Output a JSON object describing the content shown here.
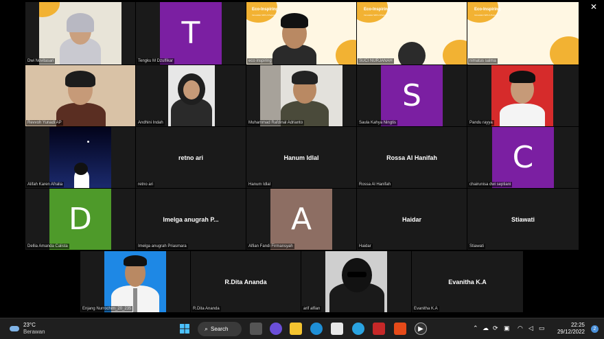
{
  "window": {
    "close_glyph": "✕"
  },
  "participants": [
    {
      "name": "Dwi Novitasari"
    },
    {
      "name": "Tengku M Dzulfikar",
      "initial": "T",
      "color": "#7b1fa2"
    },
    {
      "name": "eco inspiring",
      "banner": "Eco-Inspiring",
      "banner_sub": "Innovation With A Purpose"
    },
    {
      "name": "SUCI NURJANAH",
      "banner": "Eco-Inspiring",
      "banner_sub": "Innovation With A Purpose"
    },
    {
      "name": "nimatus salma",
      "banner": "Eco-Inspiring",
      "banner_sub": "Innovation With A Purpose"
    },
    {
      "name": "Revvoh Yunadi AP"
    },
    {
      "name": "Andhini Indah"
    },
    {
      "name": "Muhammad Rafdinal Adrianto"
    },
    {
      "name": "Saula Kahya Ningtis",
      "initial": "S",
      "color": "#7b1fa2"
    },
    {
      "name": "Pandu rayya"
    },
    {
      "name": "Alifah Karen Afralia"
    },
    {
      "name": "retno ari",
      "display": "retno ari"
    },
    {
      "name": "Hanum Idlal",
      "display": "Hanum Idlal"
    },
    {
      "name": "Rossa Al Hanifah",
      "display": "Rossa Al Hanifah"
    },
    {
      "name": "chairunisa dwi septiani",
      "initial": "C",
      "color": "#7b1fa2"
    },
    {
      "name": "Dellia Amanda Calista",
      "initial": "D",
      "color": "#4e9a2a"
    },
    {
      "name": "Imelga anugrah Priasmara",
      "display": "Imelga anugrah P..."
    },
    {
      "name": "Alfian Fandi Firmansyah",
      "initial": "A",
      "color": "#8d6e63"
    },
    {
      "name": "Haidar",
      "display": "Haidar"
    },
    {
      "name": "Stiawati",
      "display": "Stiawati"
    },
    {
      "name": "Enjang Nurrochim_20_235"
    },
    {
      "name": "R.Dita Ananda",
      "display": "R.Dita Ananda"
    },
    {
      "name": "arif alfian"
    },
    {
      "name": "Evanitha K.A",
      "display": "Evanitha K.A"
    }
  ],
  "taskbar": {
    "weather_temp": "23°C",
    "weather_cond": "Berawan",
    "search_label": "Search",
    "time": "22:25",
    "date": "29/12/2022",
    "notifications": "2"
  }
}
